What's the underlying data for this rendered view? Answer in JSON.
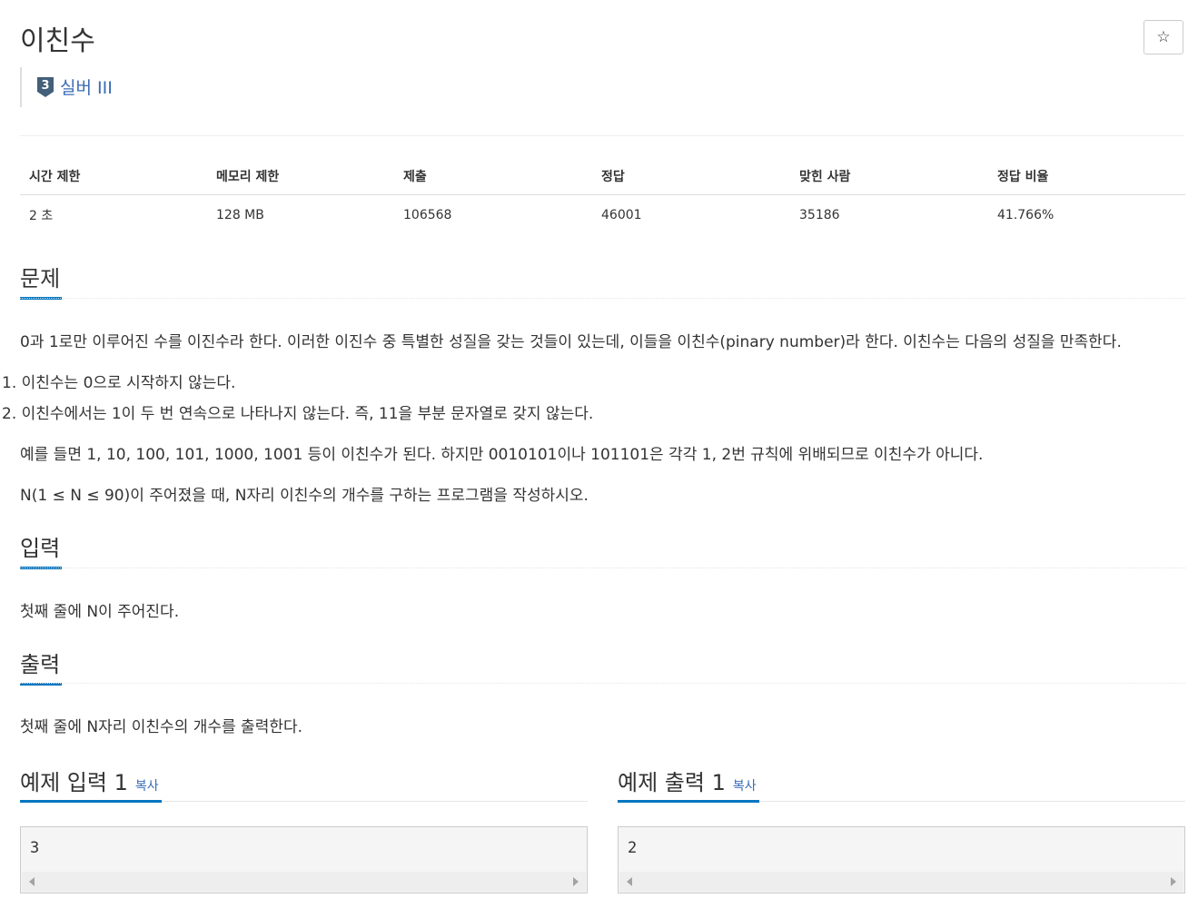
{
  "problem": {
    "title": "이친수",
    "tier_label": "실버 III",
    "tier_number": "3",
    "star_icon": "☆"
  },
  "info_table": {
    "headers": [
      "시간 제한",
      "메모리 제한",
      "제출",
      "정답",
      "맞힌 사람",
      "정답 비율"
    ],
    "values": [
      "2 초",
      "128 MB",
      "106568",
      "46001",
      "35186",
      "41.766%"
    ]
  },
  "sections": {
    "problem_heading": "문제",
    "problem_p1": "0과 1로만 이루어진 수를 이진수라 한다. 이러한 이진수 중 특별한 성질을 갖는 것들이 있는데, 이들을 이친수(pinary number)라 한다. 이친수는 다음의 성질을 만족한다.",
    "problem_li1": "1. 이친수는 0으로 시작하지 않는다.",
    "problem_li2": "2. 이친수에서는 1이 두 번 연속으로 나타나지 않는다. 즉, 11을 부분 문자열로 갖지 않는다.",
    "problem_p2": "예를 들면 1, 10, 100, 101, 1000, 1001 등이 이친수가 된다. 하지만 0010101이나 101101은 각각 1, 2번 규칙에 위배되므로 이친수가 아니다.",
    "problem_p3": "N(1 ≤ N ≤ 90)이 주어졌을 때, N자리 이친수의 개수를 구하는 프로그램을 작성하시오.",
    "input_heading": "입력",
    "input_text": "첫째 줄에 N이 주어진다.",
    "output_heading": "출력",
    "output_text": "첫째 줄에 N자리 이친수의 개수를 출력한다."
  },
  "examples": {
    "input_heading": "예제 입력 1",
    "output_heading": "예제 출력 1",
    "copy_label": "복사",
    "input_value": "3",
    "output_value": "2"
  },
  "colors": {
    "accent": "#0076c0",
    "tier_silver": "#435f7a",
    "link": "#3a6bb5"
  }
}
